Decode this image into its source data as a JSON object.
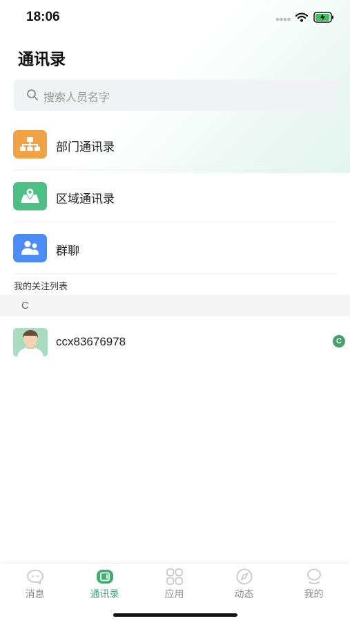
{
  "status_bar": {
    "time": "18:06"
  },
  "header": {
    "title": "通讯录"
  },
  "search": {
    "placeholder": "搜索人员名字"
  },
  "menu": [
    {
      "label": "部门通讯录",
      "icon": "org-chart-icon",
      "color": "#f0a245"
    },
    {
      "label": "区域通讯录",
      "icon": "map-pin-icon",
      "color": "#4cbf85"
    },
    {
      "label": "群聊",
      "icon": "group-users-icon",
      "color": "#4c8df5"
    }
  ],
  "following": {
    "section_title": "我的关注列表",
    "index_letter": "C",
    "contacts": [
      {
        "name": "ccx83676978",
        "badge": "C",
        "badge_color": "#45a06a"
      }
    ]
  },
  "tabs": [
    {
      "label": "消息",
      "icon": "chat-bubble-icon",
      "active": false
    },
    {
      "label": "通讯录",
      "icon": "contacts-icon",
      "active": true
    },
    {
      "label": "应用",
      "icon": "apps-grid-icon",
      "active": false
    },
    {
      "label": "动态",
      "icon": "compass-icon",
      "active": false
    },
    {
      "label": "我的",
      "icon": "profile-icon",
      "active": false
    }
  ],
  "colors": {
    "accent": "#3fae6f",
    "inactive": "#8c8c8c"
  }
}
